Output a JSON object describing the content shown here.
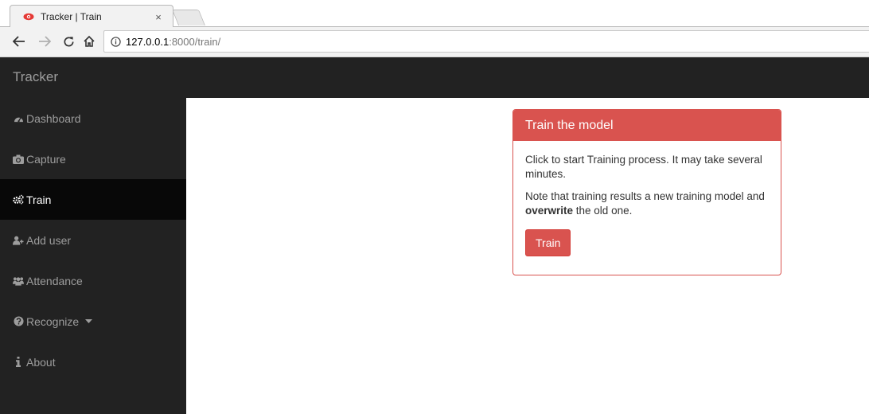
{
  "browser": {
    "tab_title": "Tracker | Train",
    "tab_close": "×",
    "url_host": "127.0.0.1",
    "url_path": ":8000/train/",
    "icons": {
      "favicon": "eye-icon",
      "back": "back-arrow-icon",
      "forward": "forward-arrow-icon",
      "reload": "reload-icon",
      "home": "home-icon",
      "info": "info-icon"
    }
  },
  "app": {
    "brand": "Tracker"
  },
  "sidebar": {
    "items": [
      {
        "label": "Dashboard",
        "icon": "dashboard-icon",
        "active": false
      },
      {
        "label": "Capture",
        "icon": "camera-icon",
        "active": false
      },
      {
        "label": "Train",
        "icon": "cogs-icon",
        "active": true
      },
      {
        "label": "Add user",
        "icon": "add-user-icon",
        "active": false
      },
      {
        "label": "Attendance",
        "icon": "users-icon",
        "active": false
      },
      {
        "label": "Recognize",
        "icon": "question-circle-icon",
        "active": false,
        "dropdown": true
      },
      {
        "label": "About",
        "icon": "info-letter-icon",
        "active": false
      }
    ]
  },
  "panel": {
    "heading": "Train the model",
    "line1": "Click to start Training process. It may take several minutes.",
    "line2_before": "Note that training results a new training model and ",
    "line2_bold": "overwrite",
    "line2_after": " the old one.",
    "button_label": "Train"
  },
  "colors": {
    "danger": "#d9534f",
    "navbar": "#222222",
    "nav_active": "#080808",
    "nav_text": "#9d9d9d"
  }
}
